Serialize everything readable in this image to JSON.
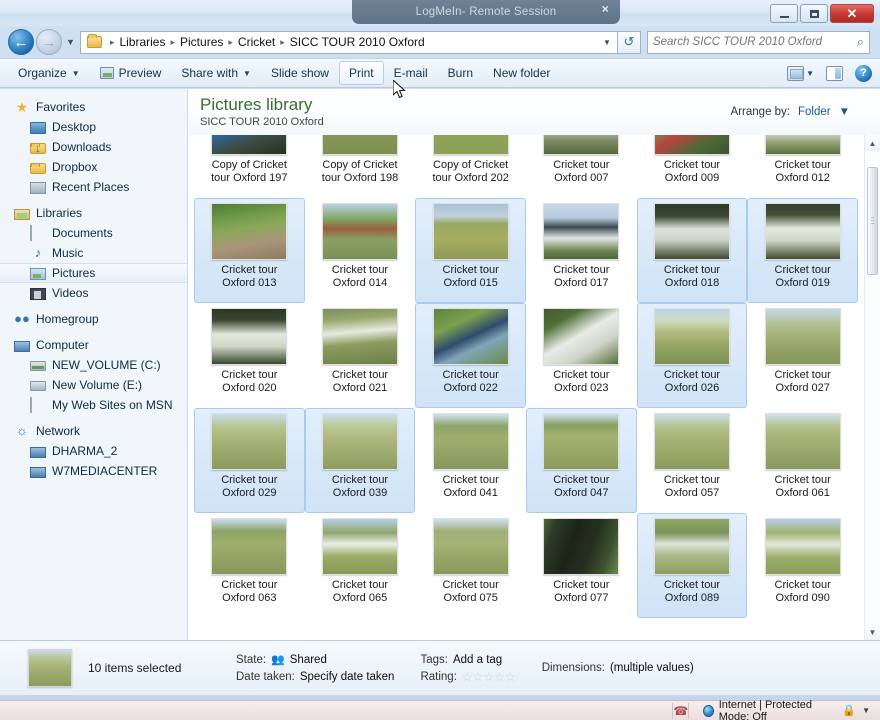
{
  "window": {
    "remote_banner_brand": "LogMeIn",
    "remote_banner_rest": " - Remote Session",
    "remote_banner_close": "×",
    "minimize_label": "–",
    "maximize_label": "□",
    "close_label": "✕"
  },
  "address_bar": {
    "back_icon": "←",
    "forward_icon": "→",
    "history_caret": "▼",
    "folder_icon": "folder-icon",
    "crumbs": [
      "Libraries",
      "Pictures",
      "Cricket",
      "SICC TOUR 2010 Oxford"
    ],
    "separator": "▸",
    "dropdown_caret": "▼",
    "refresh_icon": "↺",
    "search_placeholder": "Search SICC TOUR 2010 Oxford",
    "search_value": "",
    "search_icon": "⌕"
  },
  "toolbar": {
    "organize": "Organize",
    "preview": "Preview",
    "share_with": "Share with",
    "slide_show": "Slide show",
    "print": "Print",
    "email": "E-mail",
    "burn": "Burn",
    "new_folder": "New folder",
    "caret": "▼",
    "help_label": "?"
  },
  "sidebar": {
    "groups": [
      {
        "header": {
          "label": "Favorites",
          "icon": "star-icon"
        },
        "items": [
          {
            "label": "Desktop",
            "icon": "monitor-icon"
          },
          {
            "label": "Downloads",
            "icon": "folder-download-icon"
          },
          {
            "label": "Dropbox",
            "icon": "folder-icon"
          },
          {
            "label": "Recent Places",
            "icon": "recent-places-icon"
          }
        ]
      },
      {
        "header": {
          "label": "Libraries",
          "icon": "library-icon"
        },
        "items": [
          {
            "label": "Documents",
            "icon": "document-icon"
          },
          {
            "label": "Music",
            "icon": "music-note-icon"
          },
          {
            "label": "Pictures",
            "icon": "picture-icon",
            "selected": true
          },
          {
            "label": "Videos",
            "icon": "video-icon"
          }
        ]
      },
      {
        "header": {
          "label": "Homegroup",
          "icon": "homegroup-icon"
        },
        "items": []
      },
      {
        "header": {
          "label": "Computer",
          "icon": "computer-icon"
        },
        "items": [
          {
            "label": "NEW_VOLUME (C:)",
            "icon": "hard-drive-icon"
          },
          {
            "label": "New Volume (E:)",
            "icon": "hard-drive-icon"
          },
          {
            "label": "My Web Sites on MSN",
            "icon": "file-icon"
          }
        ]
      },
      {
        "header": {
          "label": "Network",
          "icon": "network-icon"
        },
        "items": [
          {
            "label": "DHARMA_2",
            "icon": "computer-icon"
          },
          {
            "label": "W7MEDIACENTER",
            "icon": "computer-icon"
          }
        ]
      }
    ]
  },
  "library_header": {
    "title": "Pictures library",
    "subtitle": "SICC TOUR 2010 Oxford",
    "arrange_label": "Arrange by:",
    "arrange_value": "Folder",
    "arrange_caret": "▼"
  },
  "files": [
    {
      "name": "Copy of Cricket tour Oxford 197",
      "selected": false,
      "thumb": "c1"
    },
    {
      "name": "Copy of Cricket tour Oxford 198",
      "selected": false,
      "thumb": "c2"
    },
    {
      "name": "Copy of Cricket tour Oxford 202",
      "selected": false,
      "thumb": "c3"
    },
    {
      "name": "Cricket tour Oxford 007",
      "selected": false,
      "thumb": "c4"
    },
    {
      "name": "Cricket tour Oxford 009",
      "selected": false,
      "thumb": "c5"
    },
    {
      "name": "Cricket tour Oxford 012",
      "selected": false,
      "thumb": "c6"
    },
    {
      "name": "Cricket tour Oxford 013",
      "selected": true,
      "thumb": "g1"
    },
    {
      "name": "Cricket tour Oxford 014",
      "selected": false,
      "thumb": "g2"
    },
    {
      "name": "Cricket tour Oxford 015",
      "selected": true,
      "thumb": "g3"
    },
    {
      "name": "Cricket tour Oxford 017",
      "selected": false,
      "thumb": "t1"
    },
    {
      "name": "Cricket tour Oxford 018",
      "selected": true,
      "thumb": "t2"
    },
    {
      "name": "Cricket tour Oxford 019",
      "selected": true,
      "thumb": "t3"
    },
    {
      "name": "Cricket tour Oxford 020",
      "selected": false,
      "thumb": "t4"
    },
    {
      "name": "Cricket tour Oxford 021",
      "selected": false,
      "thumb": "p1"
    },
    {
      "name": "Cricket tour Oxford 022",
      "selected": true,
      "thumb": "g4"
    },
    {
      "name": "Cricket tour Oxford 023",
      "selected": false,
      "thumb": "p2"
    },
    {
      "name": "Cricket tour Oxford 026",
      "selected": true,
      "thumb": "f1"
    },
    {
      "name": "Cricket tour Oxford 027",
      "selected": false,
      "thumb": "f2"
    },
    {
      "name": "Cricket tour Oxford 029",
      "selected": true,
      "thumb": "f3"
    },
    {
      "name": "Cricket tour Oxford 039",
      "selected": true,
      "thumb": "f4"
    },
    {
      "name": "Cricket tour Oxford 041",
      "selected": false,
      "thumb": "f5"
    },
    {
      "name": "Cricket tour Oxford 047",
      "selected": true,
      "thumb": "f6"
    },
    {
      "name": "Cricket tour Oxford 057",
      "selected": false,
      "thumb": "f7"
    },
    {
      "name": "Cricket tour Oxford 061",
      "selected": false,
      "thumb": "f8"
    },
    {
      "name": "Cricket tour Oxford 063",
      "selected": false,
      "thumb": "f9"
    },
    {
      "name": "Cricket tour Oxford 065",
      "selected": false,
      "thumb": "p3"
    },
    {
      "name": "Cricket tour Oxford 075",
      "selected": false,
      "thumb": "f10"
    },
    {
      "name": "Cricket tour Oxford 077",
      "selected": false,
      "thumb": "sb"
    },
    {
      "name": "Cricket tour Oxford 089",
      "selected": true,
      "thumb": "p4"
    },
    {
      "name": "Cricket tour Oxford 090",
      "selected": false,
      "thumb": "p5"
    }
  ],
  "scrollbar": {
    "up_arrow": "▲",
    "down_arrow": "▼"
  },
  "details_pane": {
    "selection_text": "10 items selected",
    "state_key": "State:",
    "state_value": "Shared",
    "date_taken_key": "Date taken:",
    "date_taken_value": "Specify date taken",
    "tags_key": "Tags:",
    "tags_value": "Add a tag",
    "rating_key": "Rating:",
    "rating_stars": "☆☆☆☆☆",
    "dimensions_key": "Dimensions:",
    "dimensions_value": "(multiple values)"
  },
  "status_bar": {
    "zone_text": "Internet | Protected Mode: Off",
    "zoom_caret": "▼"
  },
  "colors": {
    "accent_blue": "#16598f",
    "library_green": "#3a6e2f",
    "selection_fill": "#cfe3f7",
    "selection_border": "#a8cdea",
    "close_red": "#c4362f"
  }
}
